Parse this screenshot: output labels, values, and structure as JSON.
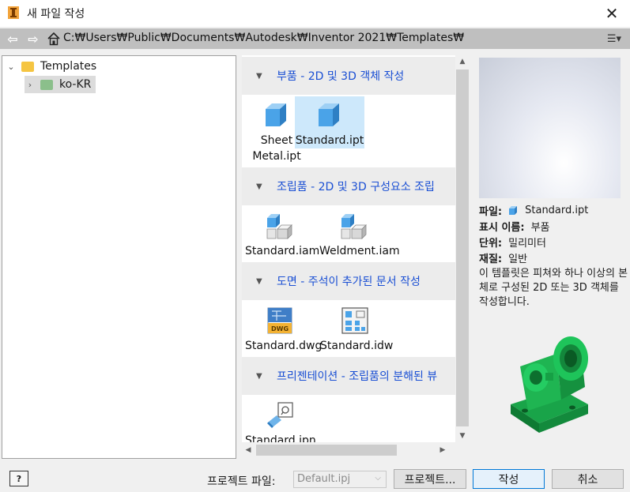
{
  "window": {
    "title": "새 파일 작성",
    "close_label": "✕"
  },
  "pathbar": {
    "path": "C:₩Users₩Public₩Documents₩Autodesk₩Inventor 2021₩Templates₩",
    "back_icon": "arrow-left-icon",
    "forward_icon": "arrow-right-icon",
    "view_label": "☰▾"
  },
  "tree": {
    "items": [
      {
        "label": "Templates",
        "expanded": true
      },
      {
        "label": "ko-KR",
        "expanded": false,
        "selected": true
      }
    ]
  },
  "groups": [
    {
      "title": "부품 - 2D 및 3D 객체 작성",
      "files": [
        {
          "name": "Sheet Metal.ipt",
          "icon": "part-cube-icon"
        },
        {
          "name": "Standard.ipt",
          "icon": "part-cube-icon",
          "selected": true
        }
      ]
    },
    {
      "title": "조립품 - 2D 및 3D 구성요소 조립",
      "files": [
        {
          "name": "Standard.iam",
          "icon": "assembly-icon"
        },
        {
          "name": "Weldment.iam",
          "icon": "assembly-icon"
        }
      ]
    },
    {
      "title": "도면 - 주석이 추가된 문서 작성",
      "files": [
        {
          "name": "Standard.dwg",
          "icon": "dwg-icon"
        },
        {
          "name": "Standard.idw",
          "icon": "idw-icon"
        }
      ]
    },
    {
      "title": "프리젠테이션 - 조립품의 분해된 뷰",
      "files": [
        {
          "name": "Standard.ipn",
          "icon": "presentation-icon"
        }
      ]
    }
  ],
  "details": {
    "file_key": "파일:",
    "file_value": "Standard.ipt",
    "display_name_key": "표시 이름:",
    "display_name_value": "부품",
    "unit_key": "단위:",
    "unit_value": "밀리미터",
    "material_key": "재질:",
    "material_value": "일반",
    "description": "이 템플릿은 피쳐와 하나 이상의 본체로 구성된 2D 또는 3D 객체를 작성합니다."
  },
  "bottom": {
    "help_label": "?",
    "project_file_label": "프로젝트 파일:",
    "project_file_value": "Default.ipj",
    "projects_button": "프로젝트...",
    "create_button": "작성",
    "cancel_button": "취소"
  },
  "colors": {
    "accent_blue": "#1a4fd4",
    "selection": "#cde8fb",
    "preview_part": "#17a34a"
  }
}
